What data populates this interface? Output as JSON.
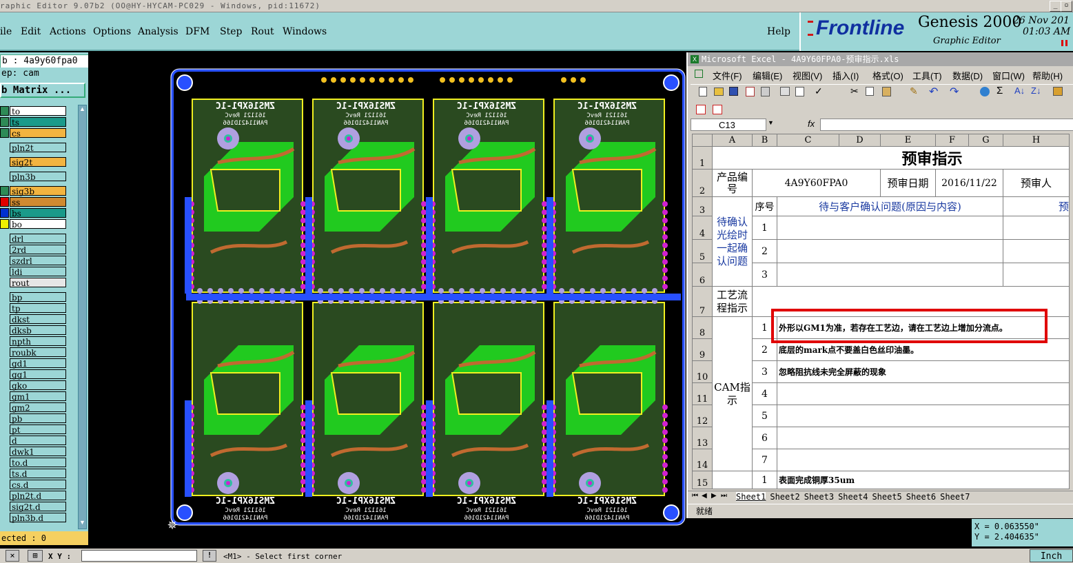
{
  "window": {
    "title": "raphic Editor 9.07b2 (OO@HY-HYCAM-PC029 - Windows, pid:11672)"
  },
  "menu": {
    "items": [
      "ile",
      "Edit",
      "Actions",
      "Options",
      "Analysis",
      "DFM",
      "Step",
      "Rout",
      "Windows"
    ],
    "help": "Help"
  },
  "brand": {
    "logo": "Frontline",
    "product": "Genesis 2000",
    "subtitle": "Graphic Editor",
    "date": "26 Nov 201",
    "time": "01:03 AM"
  },
  "left": {
    "job": "b : 4a9y60fpa0",
    "step": "ep: cam",
    "matrix_button": "b Matrix ...",
    "layers": [
      {
        "name": "to",
        "bg": "#ffffff",
        "sw": "#2e8b57"
      },
      {
        "name": "ts",
        "bg": "#1a9a8a",
        "sw": "#2e8b57"
      },
      {
        "name": "cs",
        "bg": "#f2b440",
        "sw": "#2e8b57"
      },
      {
        "name": "pln2t",
        "bg": "#9cd6d6",
        "sw": ""
      },
      {
        "name": "sig2t",
        "bg": "#f2b440",
        "sw": ""
      },
      {
        "name": "pln3b",
        "bg": "#9cd6d6",
        "sw": ""
      },
      {
        "name": "sig3b",
        "bg": "#f2b440",
        "sw": "#2e8b57"
      },
      {
        "name": "ss",
        "bg": "#d08a30",
        "sw": "#e00000"
      },
      {
        "name": "bs",
        "bg": "#1a9a8a",
        "sw": "#0030d0"
      },
      {
        "name": "bo",
        "bg": "#ffffff",
        "sw": "#f0f000"
      },
      {
        "name": "drl",
        "bg": "#9cd6d6",
        "sw": ""
      },
      {
        "name": "2rd",
        "bg": "#9cd6d6",
        "sw": ""
      },
      {
        "name": "szdrl",
        "bg": "#9cd6d6",
        "sw": ""
      },
      {
        "name": "ldi",
        "bg": "#9cd6d6",
        "sw": ""
      },
      {
        "name": "rout",
        "bg": "#e6e6e6",
        "sw": ""
      },
      {
        "name": "bp",
        "bg": "#9cd6d6",
        "sw": ""
      },
      {
        "name": "tp",
        "bg": "#9cd6d6",
        "sw": ""
      },
      {
        "name": "dkst",
        "bg": "#9cd6d6",
        "sw": ""
      },
      {
        "name": "dksb",
        "bg": "#9cd6d6",
        "sw": ""
      },
      {
        "name": "npth",
        "bg": "#9cd6d6",
        "sw": ""
      },
      {
        "name": "roubk",
        "bg": "#9cd6d6",
        "sw": ""
      },
      {
        "name": "gd1",
        "bg": "#9cd6d6",
        "sw": ""
      },
      {
        "name": "gg1",
        "bg": "#9cd6d6",
        "sw": ""
      },
      {
        "name": "gko",
        "bg": "#9cd6d6",
        "sw": ""
      },
      {
        "name": "gm1",
        "bg": "#9cd6d6",
        "sw": ""
      },
      {
        "name": "gm2",
        "bg": "#9cd6d6",
        "sw": ""
      },
      {
        "name": "pb",
        "bg": "#9cd6d6",
        "sw": ""
      },
      {
        "name": "pt",
        "bg": "#9cd6d6",
        "sw": ""
      },
      {
        "name": "d",
        "bg": "#9cd6d6",
        "sw": ""
      },
      {
        "name": "dwk1",
        "bg": "#9cd6d6",
        "sw": ""
      },
      {
        "name": "to.d",
        "bg": "#9cd6d6",
        "sw": ""
      },
      {
        "name": "ts.d",
        "bg": "#9cd6d6",
        "sw": ""
      },
      {
        "name": "cs.d",
        "bg": "#9cd6d6",
        "sw": ""
      },
      {
        "name": "pln2t.d",
        "bg": "#9cd6d6",
        "sw": ""
      },
      {
        "name": "sig2t.d",
        "bg": "#9cd6d6",
        "sw": ""
      },
      {
        "name": "pln3b.d",
        "bg": "#9cd6d6",
        "sw": ""
      }
    ],
    "selected": "ected : 0"
  },
  "pcb": {
    "board_text_top": "ZMS16XP1-1C",
    "board_rev_top": "161121 RevC",
    "board_pan_top": "PAN11421D166"
  },
  "excel": {
    "title": "Microsoft Excel - 4A9Y60FPA0-预审指示.xls",
    "menus": [
      "文件(F)",
      "编辑(E)",
      "视图(V)",
      "插入(I)",
      "格式(O)",
      "工具(T)",
      "数据(D)",
      "窗口(W)",
      "帮助(H)"
    ],
    "cell_ref": "C13",
    "fx": "fx",
    "columns": [
      "A",
      "B",
      "C",
      "D",
      "E",
      "F",
      "G",
      "H"
    ],
    "sheet_title": "预审指示",
    "row2": {
      "a": "产品编号",
      "c": "4A9Y60FPA0",
      "e": "预审日期",
      "f": "2016/11/22",
      "h": "预审人"
    },
    "row3": {
      "b": "序号",
      "c": "待与客户确认问题(原因与内容)",
      "h": "预"
    },
    "confirm_label": "待确认光绘时一起确认问题",
    "process_label": "工艺流程指示",
    "cam_label": "CAM指示",
    "cam_items": [
      {
        "n": "1",
        "text": "外形以GM1为准，若存在工艺边，请在工艺边上增加分流点。"
      },
      {
        "n": "2",
        "text": "底层的mark点不要盖白色丝印油墨。"
      },
      {
        "n": "3",
        "text": "忽略阻抗线未完全屏蔽的现象"
      },
      {
        "n": "4",
        "text": ""
      },
      {
        "n": "5",
        "text": ""
      },
      {
        "n": "6",
        "text": ""
      },
      {
        "n": "7",
        "text": ""
      }
    ],
    "row15": {
      "n": "1",
      "text": "表面完成铜厚35um"
    },
    "sheets": [
      "Sheet1",
      "Sheet2",
      "Sheet3",
      "Sheet4",
      "Sheet5",
      "Sheet6",
      "Sheet7"
    ],
    "status": "就绪"
  },
  "coords": {
    "x": "X = 0.063550\"",
    "y": "Y = 2.404635\""
  },
  "cmd": {
    "xy_label": "X Y :",
    "prompt": "<M1> - Select first corner",
    "unit": "Inch"
  }
}
